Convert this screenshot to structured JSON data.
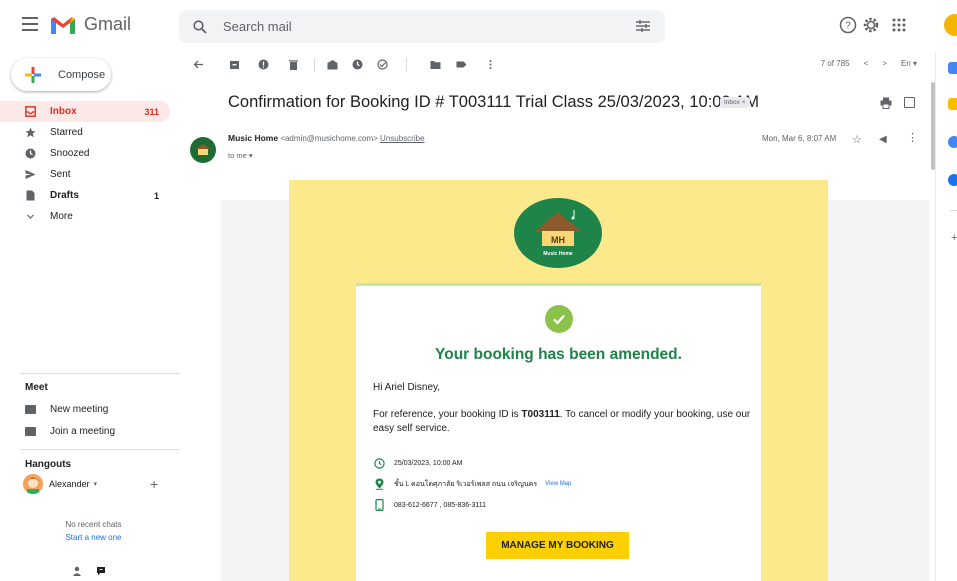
{
  "app": {
    "name": "Gmail",
    "search_placeholder": "Search mail"
  },
  "sidebar": {
    "compose_label": "Compose",
    "items": [
      {
        "label": "Inbox",
        "count": "311",
        "icon": "inbox-icon",
        "active": true,
        "bold": true
      },
      {
        "label": "Starred",
        "count": "",
        "icon": "star-icon",
        "active": false,
        "bold": false
      },
      {
        "label": "Snoozed",
        "count": "",
        "icon": "clock-icon",
        "active": false,
        "bold": false
      },
      {
        "label": "Sent",
        "count": "",
        "icon": "send-icon",
        "active": false,
        "bold": false
      },
      {
        "label": "Drafts",
        "count": "1",
        "icon": "draft-icon",
        "active": false,
        "bold": true
      },
      {
        "label": "More",
        "count": "",
        "icon": "chevron-down-icon",
        "active": false,
        "bold": false
      }
    ],
    "meet": {
      "title": "Meet",
      "new_meeting": "New meeting",
      "join_meeting": "Join a meeting"
    },
    "hangouts": {
      "title": "Hangouts",
      "user": "Alexander",
      "no_chats": "No recent chats",
      "start_new": "Start a new one"
    }
  },
  "toolbar": {
    "pager": "7 of 785",
    "lang": "En"
  },
  "email": {
    "subject": "Confirmation for Booking ID # T003111 Trial Class 25/03/2023, 10:00 AM",
    "label_chip": "Inbox ×",
    "sender_name": "Music Home",
    "sender_email": "<admin@musichome.com>",
    "unsubscribe": "Unsubscribe",
    "to": "to me",
    "date": "Mon, Mar 6, 8:07 AM"
  },
  "body": {
    "logo_text": "MH",
    "logo_sub": "Music Home",
    "headline": "Your booking has been amended.",
    "greeting": "Hi Ariel Disney,",
    "para_pre": "For reference, your booking ID is ",
    "booking_id": "T003111",
    "para_post": ". To cancel or modify your booking, use our easy self service.",
    "datetime": "25/03/2023, 10:00 AM",
    "location": "ชั้น L คอนโดศุภาลัย ริเวอร์เพลส ถนน เจริญนคร",
    "view_map": "View Map",
    "phone": "083-612-6677 ,  085-836-3111",
    "button": "MANAGE MY BOOKING"
  },
  "colors": {
    "accent_red": "#d93025",
    "brand_green": "#1e8449",
    "banner_yellow": "#fbe98c",
    "button_yellow": "#fcd000"
  }
}
